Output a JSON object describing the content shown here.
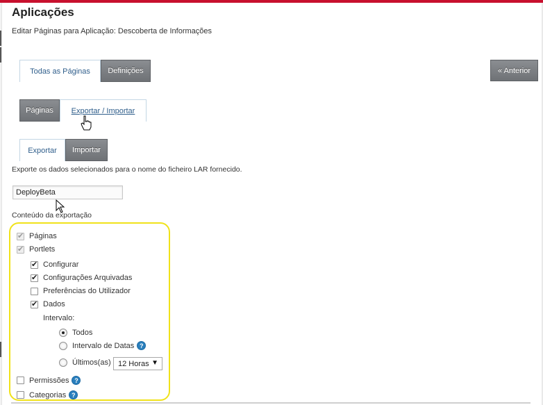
{
  "page": {
    "title": "Aplicações",
    "subtitle": "Editar Páginas para Aplicação: Descoberta de Informações"
  },
  "tabs_main": [
    {
      "label": "Todas as Páginas",
      "active": true
    },
    {
      "label": "Definições",
      "active": false
    }
  ],
  "prev_button": "« Anterior",
  "tabs_sub": [
    {
      "label": "Páginas",
      "active": false
    },
    {
      "label": "Exportar / Importar",
      "active": true
    }
  ],
  "tabs_export": [
    {
      "label": "Exportar",
      "active": true
    },
    {
      "label": "Importar",
      "active": false
    }
  ],
  "export": {
    "description": "Exporte os dados selecionados para o nome do ficheiro LAR fornecido.",
    "filename_value": "DeployBeta",
    "content_label": "Conteúdo da exportação",
    "options": {
      "paginas": {
        "label": "Páginas",
        "checked": true,
        "disabled": true
      },
      "portlets": {
        "label": "Portlets",
        "checked": true,
        "disabled": true
      },
      "configurar": {
        "label": "Configurar",
        "checked": true
      },
      "config_arquivadas": {
        "label": "Configurações Arquivadas",
        "checked": true
      },
      "preferencias": {
        "label": "Preferências do Utilizador",
        "checked": false
      },
      "dados": {
        "label": "Dados",
        "checked": true
      },
      "intervalo_label": "Intervalo:",
      "range_todos": {
        "label": "Todos",
        "selected": true
      },
      "range_datas": {
        "label": "Intervalo de Datas",
        "selected": false
      },
      "range_ultimos": {
        "label": "Últimos(as)",
        "selected": false
      },
      "ultimos_select_value": "12 Horas",
      "permissoes": {
        "label": "Permissões",
        "checked": false
      },
      "categorias": {
        "label": "Categorias",
        "checked": false
      }
    }
  },
  "icons": {
    "help": "question-mark-icon",
    "select_arrow": "triangle-down-icon"
  },
  "colors": {
    "top_accent": "#c8102e",
    "tab_active_text": "#2f5e8b",
    "tab_inactive_bg": "#7c7f83",
    "highlight": "#f0e21a",
    "help_icon": "#2a7fbd"
  }
}
